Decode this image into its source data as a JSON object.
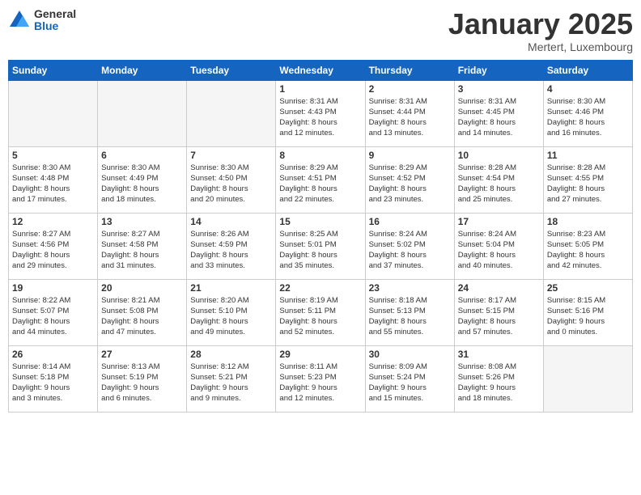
{
  "header": {
    "logo_general": "General",
    "logo_blue": "Blue",
    "month_title": "January 2025",
    "location": "Mertert, Luxembourg"
  },
  "days_of_week": [
    "Sunday",
    "Monday",
    "Tuesday",
    "Wednesday",
    "Thursday",
    "Friday",
    "Saturday"
  ],
  "weeks": [
    [
      {
        "day": "",
        "info": ""
      },
      {
        "day": "",
        "info": ""
      },
      {
        "day": "",
        "info": ""
      },
      {
        "day": "1",
        "info": "Sunrise: 8:31 AM\nSunset: 4:43 PM\nDaylight: 8 hours\nand 12 minutes."
      },
      {
        "day": "2",
        "info": "Sunrise: 8:31 AM\nSunset: 4:44 PM\nDaylight: 8 hours\nand 13 minutes."
      },
      {
        "day": "3",
        "info": "Sunrise: 8:31 AM\nSunset: 4:45 PM\nDaylight: 8 hours\nand 14 minutes."
      },
      {
        "day": "4",
        "info": "Sunrise: 8:30 AM\nSunset: 4:46 PM\nDaylight: 8 hours\nand 16 minutes."
      }
    ],
    [
      {
        "day": "5",
        "info": "Sunrise: 8:30 AM\nSunset: 4:48 PM\nDaylight: 8 hours\nand 17 minutes."
      },
      {
        "day": "6",
        "info": "Sunrise: 8:30 AM\nSunset: 4:49 PM\nDaylight: 8 hours\nand 18 minutes."
      },
      {
        "day": "7",
        "info": "Sunrise: 8:30 AM\nSunset: 4:50 PM\nDaylight: 8 hours\nand 20 minutes."
      },
      {
        "day": "8",
        "info": "Sunrise: 8:29 AM\nSunset: 4:51 PM\nDaylight: 8 hours\nand 22 minutes."
      },
      {
        "day": "9",
        "info": "Sunrise: 8:29 AM\nSunset: 4:52 PM\nDaylight: 8 hours\nand 23 minutes."
      },
      {
        "day": "10",
        "info": "Sunrise: 8:28 AM\nSunset: 4:54 PM\nDaylight: 8 hours\nand 25 minutes."
      },
      {
        "day": "11",
        "info": "Sunrise: 8:28 AM\nSunset: 4:55 PM\nDaylight: 8 hours\nand 27 minutes."
      }
    ],
    [
      {
        "day": "12",
        "info": "Sunrise: 8:27 AM\nSunset: 4:56 PM\nDaylight: 8 hours\nand 29 minutes."
      },
      {
        "day": "13",
        "info": "Sunrise: 8:27 AM\nSunset: 4:58 PM\nDaylight: 8 hours\nand 31 minutes."
      },
      {
        "day": "14",
        "info": "Sunrise: 8:26 AM\nSunset: 4:59 PM\nDaylight: 8 hours\nand 33 minutes."
      },
      {
        "day": "15",
        "info": "Sunrise: 8:25 AM\nSunset: 5:01 PM\nDaylight: 8 hours\nand 35 minutes."
      },
      {
        "day": "16",
        "info": "Sunrise: 8:24 AM\nSunset: 5:02 PM\nDaylight: 8 hours\nand 37 minutes."
      },
      {
        "day": "17",
        "info": "Sunrise: 8:24 AM\nSunset: 5:04 PM\nDaylight: 8 hours\nand 40 minutes."
      },
      {
        "day": "18",
        "info": "Sunrise: 8:23 AM\nSunset: 5:05 PM\nDaylight: 8 hours\nand 42 minutes."
      }
    ],
    [
      {
        "day": "19",
        "info": "Sunrise: 8:22 AM\nSunset: 5:07 PM\nDaylight: 8 hours\nand 44 minutes."
      },
      {
        "day": "20",
        "info": "Sunrise: 8:21 AM\nSunset: 5:08 PM\nDaylight: 8 hours\nand 47 minutes."
      },
      {
        "day": "21",
        "info": "Sunrise: 8:20 AM\nSunset: 5:10 PM\nDaylight: 8 hours\nand 49 minutes."
      },
      {
        "day": "22",
        "info": "Sunrise: 8:19 AM\nSunset: 5:11 PM\nDaylight: 8 hours\nand 52 minutes."
      },
      {
        "day": "23",
        "info": "Sunrise: 8:18 AM\nSunset: 5:13 PM\nDaylight: 8 hours\nand 55 minutes."
      },
      {
        "day": "24",
        "info": "Sunrise: 8:17 AM\nSunset: 5:15 PM\nDaylight: 8 hours\nand 57 minutes."
      },
      {
        "day": "25",
        "info": "Sunrise: 8:15 AM\nSunset: 5:16 PM\nDaylight: 9 hours\nand 0 minutes."
      }
    ],
    [
      {
        "day": "26",
        "info": "Sunrise: 8:14 AM\nSunset: 5:18 PM\nDaylight: 9 hours\nand 3 minutes."
      },
      {
        "day": "27",
        "info": "Sunrise: 8:13 AM\nSunset: 5:19 PM\nDaylight: 9 hours\nand 6 minutes."
      },
      {
        "day": "28",
        "info": "Sunrise: 8:12 AM\nSunset: 5:21 PM\nDaylight: 9 hours\nand 9 minutes."
      },
      {
        "day": "29",
        "info": "Sunrise: 8:11 AM\nSunset: 5:23 PM\nDaylight: 9 hours\nand 12 minutes."
      },
      {
        "day": "30",
        "info": "Sunrise: 8:09 AM\nSunset: 5:24 PM\nDaylight: 9 hours\nand 15 minutes."
      },
      {
        "day": "31",
        "info": "Sunrise: 8:08 AM\nSunset: 5:26 PM\nDaylight: 9 hours\nand 18 minutes."
      },
      {
        "day": "",
        "info": ""
      }
    ]
  ]
}
